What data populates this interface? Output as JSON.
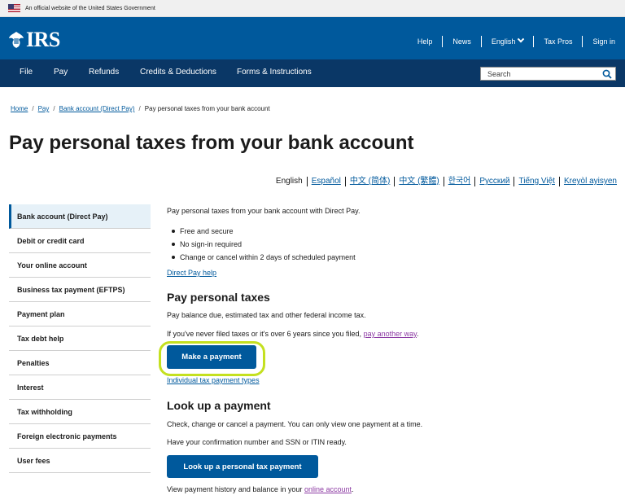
{
  "gov_banner": {
    "text": "An official website of the United States Government"
  },
  "header": {
    "logo_text": "IRS",
    "utility_links": [
      "Help",
      "News",
      "English",
      "Tax Pros",
      "Sign in"
    ]
  },
  "nav": {
    "items": [
      "File",
      "Pay",
      "Refunds",
      "Credits & Deductions",
      "Forms & Instructions"
    ],
    "search_placeholder": "Search"
  },
  "breadcrumb": {
    "items": [
      "Home",
      "Pay",
      "Bank account (Direct Pay)"
    ],
    "current": "Pay personal taxes from your bank account"
  },
  "page_title": "Pay personal taxes from your bank account",
  "languages": {
    "current": "English",
    "others": [
      "Español",
      "中文 (简体)",
      "中文 (繁體)",
      "한국어",
      "Русский",
      "Tiếng Việt",
      "Kreyòl ayisyen"
    ]
  },
  "sidenav": {
    "items": [
      "Bank account (Direct Pay)",
      "Debit or credit card",
      "Your online account",
      "Business tax payment (EFTPS)",
      "Payment plan",
      "Tax debt help",
      "Penalties",
      "Interest",
      "Tax withholding",
      "Foreign electronic payments",
      "User fees"
    ],
    "active_index": 0
  },
  "main": {
    "intro": "Pay personal taxes from your bank account with Direct Pay.",
    "bullets": [
      "Free and secure",
      "No sign-in required",
      "Change or cancel within 2 days of scheduled payment"
    ],
    "direct_pay_help": "Direct Pay help",
    "section1": {
      "heading": "Pay personal taxes",
      "text": "Pay balance due, estimated tax and other federal income tax.",
      "never_filed_text": "If you've never filed taxes or it's over 6 years since you filed, ",
      "never_filed_link": "pay another way",
      "never_filed_end": ".",
      "button": "Make a payment",
      "link": "Individual tax payment types"
    },
    "section2": {
      "heading": "Look up a payment",
      "text1": "Check, change or cancel a payment. You can only view one payment at a time.",
      "text2": "Have your confirmation number and SSN or ITIN ready.",
      "button": "Look up a personal tax payment",
      "history_text": "View payment history and balance in your ",
      "history_link": "online account",
      "history_end": "."
    }
  },
  "colors": {
    "header_blue": "#00599c",
    "nav_navy": "#0a3766",
    "highlight": "#c4e020"
  }
}
